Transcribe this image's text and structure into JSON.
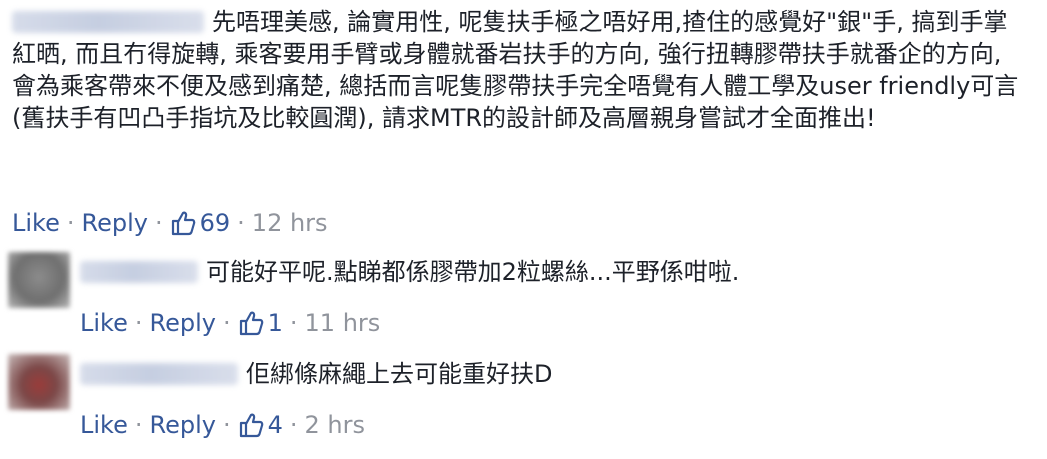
{
  "comments": [
    {
      "text_after_name": "先唔理美感, 論實用性, 呢隻扶手極之唔好用,揸住的感覺好\"銀\"手, 搞到手掌紅晒, 而且冇得旋轉, 乘客要用手臂或身體就番岩扶手的方向, 強行扭轉膠帶扶手就番企的方向, 會為乘客帶來不便及感到痛楚, 總括而言呢隻膠帶扶手完全唔覺有人體工學及user friendly可言(舊扶手有凹凸手指坑及比較圓潤), 請求MTR的設計師及高層親身嘗試才全面推出!",
      "like_label": "Like",
      "reply_label": "Reply",
      "like_count": "69",
      "time": "12 hrs"
    },
    {
      "text_after_name": "可能好平呢.點睇都係膠帶加2粒螺絲...平野係咁啦.",
      "like_label": "Like",
      "reply_label": "Reply",
      "like_count": "1",
      "time": "11 hrs"
    },
    {
      "text_after_name": "佢綁條麻繩上去可能重好扶D",
      "like_label": "Like",
      "reply_label": "Reply",
      "like_count": "4",
      "time": "2 hrs"
    }
  ],
  "separator": "·",
  "colors": {
    "link": "#365899",
    "meta": "#90949c",
    "text": "#1d2129"
  },
  "icons": {
    "like": "thumbs-up-outline-icon"
  }
}
